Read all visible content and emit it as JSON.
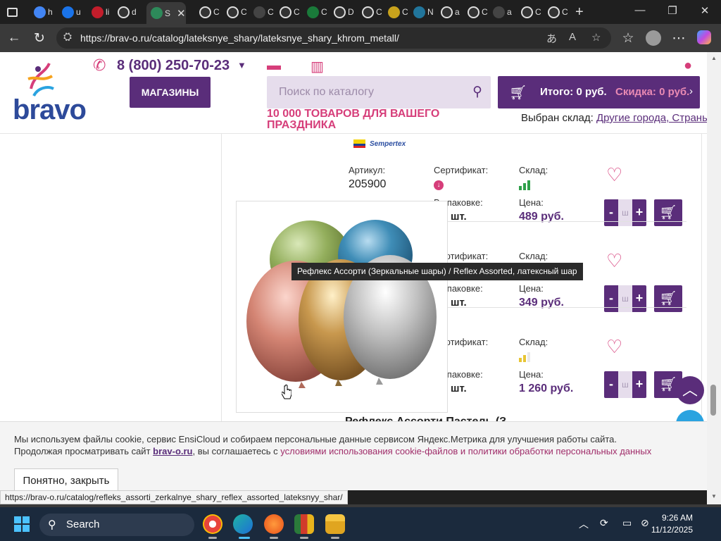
{
  "browser": {
    "tabs": [
      {
        "label": "h",
        "icon": "google-icon"
      },
      {
        "label": "u",
        "icon": "search-icon"
      },
      {
        "label": "li",
        "icon": "opera-icon"
      },
      {
        "label": "d",
        "icon": "globe-icon"
      },
      {
        "label": "S",
        "icon": "site-icon"
      },
      {
        "label": "C",
        "icon": "globe-icon"
      },
      {
        "label": "C",
        "icon": "globe-icon"
      },
      {
        "label": "C",
        "icon": "puzzle-icon"
      },
      {
        "label": "C",
        "icon": "globe-icon"
      },
      {
        "label": "C",
        "icon": "dots-icon"
      },
      {
        "label": "D",
        "icon": "globe-icon"
      },
      {
        "label": "C",
        "icon": "globe-icon"
      },
      {
        "label": "C",
        "icon": "vivaldi-icon"
      },
      {
        "label": "N",
        "icon": "wordpress-icon"
      },
      {
        "label": "a",
        "icon": "globe-icon"
      },
      {
        "label": "C",
        "icon": "globe-icon"
      },
      {
        "label": "a",
        "icon": "puzzle-icon"
      },
      {
        "label": "C",
        "icon": "globe-icon"
      },
      {
        "label": "C",
        "icon": "globe-icon"
      }
    ],
    "url": "https://brav-o.ru/catalog/lateksnye_shary/lateksnye_shary_khrom_metall/",
    "status_url": "https://brav-o.ru/catalog/refleks_assorti_zerkalnye_shary_reflex_assorted_lateksnyy_shar/",
    "new_tab": "+",
    "window": {
      "minimize": "—",
      "maximize": "❐",
      "close": "✕"
    }
  },
  "site": {
    "logo": "bravo",
    "phone": "8 (800) 250-70-23",
    "shops_button": "МАГАЗИНЫ",
    "search_placeholder": "Поиск по каталогу",
    "slogan": "10 000 ТОВАРОВ ДЛЯ ВАШЕГО ПРАЗДНИКА",
    "cart_total": "Итого: 0 руб.",
    "cart_discount": "Скидка: 0 руб.",
    "warehouse_label": "Выбран склад:",
    "warehouse_value": "Другие города, Страны"
  },
  "brand": "Sempertex",
  "labels": {
    "article": "Артикул:",
    "certificate": "Сертификат:",
    "warehouse": "Склад:",
    "package": "В упаковке:",
    "price": "Цена:",
    "qty_placeholder": "ш",
    "minus": "-",
    "plus": "+"
  },
  "products": [
    {
      "article": "205900",
      "pack": "шт.",
      "price": "489 руб.",
      "stock_color": "#2fa04a"
    },
    {
      "article": "",
      "pack": "шт.",
      "price": "349 руб.",
      "stock_color": "#2fa04a"
    },
    {
      "article": "",
      "pack": "шт.",
      "price": "1 260 руб.",
      "stock_color": "#e8c534"
    }
  ],
  "preview_tooltip": "Рефлекс Ассорти (Зеркальные шары) / Reflex Assorted, латексный шар",
  "next_product_title": "Рефлекс Ассорти Пастель (З",
  "cookie": {
    "text_1": "Мы используем файлы cookie, сервис EnsiCloud и собираем персональные данные сервисом Яндекс.Метрика для улучшения работы сайта.",
    "text_2": "Продолжая просматривать сайт",
    "brand_link": "brav-o.ru",
    "text_3": ", вы соглашаетесь с",
    "policy_link": "условиями использования cookie-файлов и политики обработки персональных данных",
    "button": "Понятно, закрыть"
  },
  "taskbar": {
    "search": "Search",
    "time": "9:26 AM",
    "date": "11/12/2025"
  }
}
